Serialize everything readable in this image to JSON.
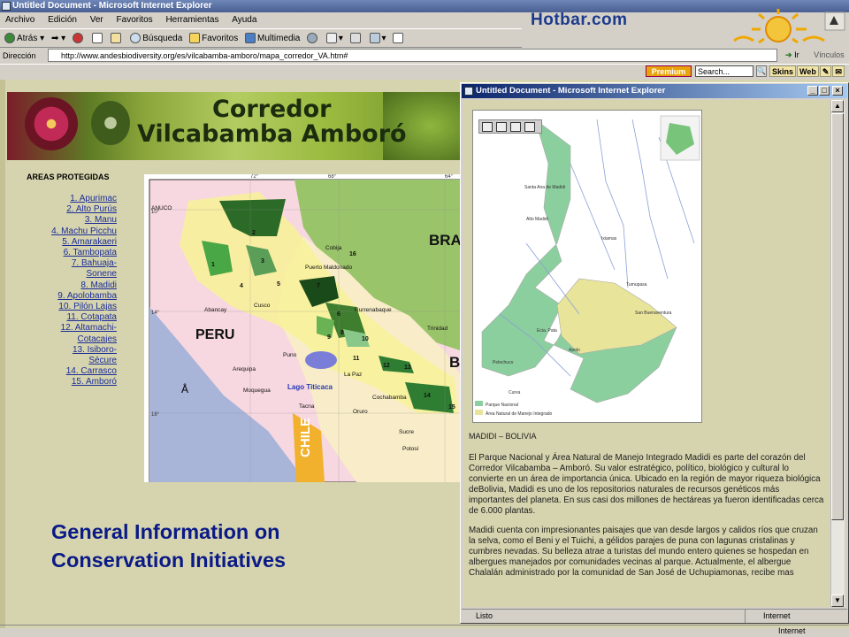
{
  "main_window": {
    "title": "Untitled Document - Microsoft Internet Explorer",
    "menu": [
      "Archivo",
      "Edición",
      "Ver",
      "Favoritos",
      "Herramientas",
      "Ayuda"
    ],
    "toolbar": {
      "back": "Atrás",
      "search": "Búsqueda",
      "favorites": "Favoritos",
      "multimedia": "Multimedia"
    },
    "address_label": "Dirección",
    "address_url": "http://www.andesbiodiversity.org/es/vilcabamba-amboro/mapa_corredor_VA.htm#",
    "go_label": "Ir",
    "links_label": "Vínculos",
    "hotbar_logo": "Hotbar.com",
    "hotbar": {
      "premium": "Premium",
      "search_value": "Search...",
      "skins": "Skins",
      "web": "Web"
    },
    "status_right": "Internet"
  },
  "page": {
    "banner_title_line1": "Corredor",
    "banner_title_line2": "Vilcabamba Amboró",
    "areas_heading": "AREAS PROTEGIDAS",
    "areas": [
      "1. Apurimac",
      "2. Alto Purús",
      "3. Manu",
      "4. Machu Picchu",
      "5. Amarakaeri",
      "6. Tambopata",
      "7. Bahuaja-",
      "Sonene",
      "8. Madidi",
      "9. Apolobamba",
      "10. Pilón Lajas",
      "11. Cotapata",
      "12. Altamachi-",
      "Cotacajes",
      "13. Isiboro-",
      "Sécure",
      "14. Carrasco",
      "15. Amboró"
    ],
    "main_map": {
      "lon_ticks": [
        "72°",
        "68°",
        "64°"
      ],
      "lat_ticks": [
        "10°",
        "14°",
        "18°"
      ],
      "country_labels": [
        "PERU",
        "CHILE",
        "BRA",
        "B"
      ],
      "places": [
        "ANUCO",
        "Cobija",
        "Puerto Maldonado",
        "Abancay",
        "Cusco",
        "Rurrenabaque",
        "Trinidad",
        "Puno",
        "Arequipa",
        "Moquegua",
        "Lago Titicaca",
        "La Paz",
        "Cochabamba",
        "Oruro",
        "Tacna",
        "Sucre",
        "Potosí"
      ],
      "area_numbers": [
        "1",
        "2",
        "3",
        "4",
        "5",
        "6",
        "7",
        "8",
        "9",
        "10",
        "11",
        "12",
        "13",
        "14",
        "15",
        "16"
      ]
    },
    "info_text_line1": "General Information on",
    "info_text_line2": "Conservation Initiatives"
  },
  "popup": {
    "title": "Untitled Document - Microsoft Internet Explorer",
    "map": {
      "places": [
        "Santa Ana de Madidi",
        "Alto Madidi",
        "Ixiamas",
        "Tumupasa",
        "San Buenaventura",
        "Ecia. Pata",
        "Apolo",
        "Pelechuco",
        "Curva"
      ],
      "legend": [
        "Parque Nacional",
        "Área Natural de Manejo Integrado"
      ]
    },
    "map_title": "MADIDI – BOLIVIA",
    "paragraph1": "El Parque Nacional y Área Natural de Manejo Integrado Madidi es parte del corazón del Corredor Vilcabamba – Amboró. Su valor estratégico, político, biológico y cultural lo convierte en un área de importancia única. Ubicado en la región de mayor riqueza biológica deBolivia, Madidi es uno de los repositorios naturales de recursos genéticos más importantes del planeta. En sus casi dos millones de hectáreas ya fueron identificadas cerca de 6.000 plantas.",
    "paragraph2": "Madidi cuenta con impresionantes paisajes que van desde largos y calidos ríos que cruzan la selva, como el Beni y el Tuichi, a gélidos parajes de puna con lagunas cristalinas y cumbres nevadas. Su belleza atrae a turistas del mundo entero quienes se hospedan en albergues manejados por comunidades vecinas al parque. Actualmente, el albergue Chalalán administrado por la comunidad de San José de Uchupiamonas, recibe mas",
    "status_left": "Listo",
    "status_right": "Internet"
  }
}
